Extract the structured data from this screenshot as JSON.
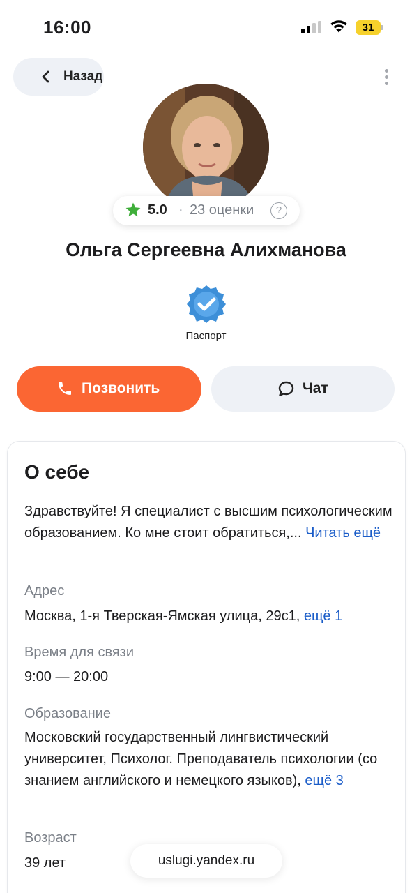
{
  "status_bar": {
    "time": "16:00",
    "battery": "31"
  },
  "header": {
    "back_label": "Назад",
    "more_icon": "more-vertical-icon"
  },
  "profile": {
    "rating": "5.0",
    "rating_separator": "·",
    "reviews_count": "23 оценки",
    "help_glyph": "?",
    "name": "Ольга Сергеевна Алихманова",
    "verification_badge": "Паспорт"
  },
  "actions": {
    "call_label": "Позвонить",
    "chat_label": "Чат"
  },
  "about": {
    "title": "О себе",
    "intro": "Здравствуйте! Я специалист с высшим психологическим образованием. Ко мне стоит обратиться,...",
    "read_more": "Читать ещё",
    "address_label": "Адрес",
    "address_value": "Москва, 1-я Тверская-Ямская улица, 29с1,",
    "address_more": "ещё 1",
    "contact_time_label": "Время для связи",
    "contact_time_value": "9:00 — 20:00",
    "education_label": "Образование",
    "education_value": "Московский государственный лингвистический университет, Психолог. Преподаватель психологии (со знанием английского и немецкого языков),",
    "education_more": "ещё 3",
    "age_label": "Возраст",
    "age_value": "39 лет"
  },
  "footer": {
    "url": "uslugi.yandex.ru"
  },
  "colors": {
    "accent": "#fb6633",
    "link": "#1a5cc8",
    "star": "#3fae3a"
  }
}
